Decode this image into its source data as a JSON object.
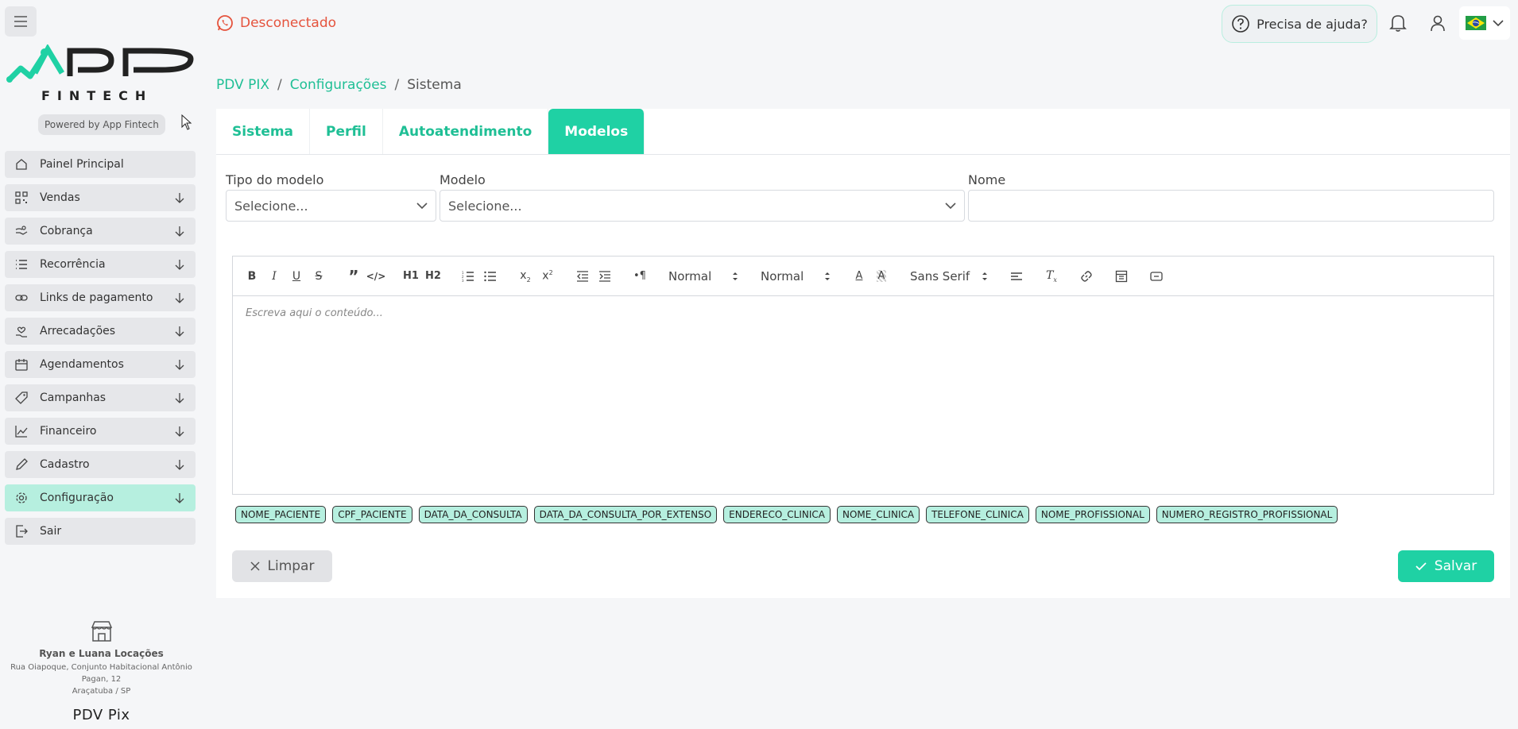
{
  "status": {
    "text": "Desconectado",
    "color": "#e5533d"
  },
  "header": {
    "help_label": "Precisa de ajuda?",
    "notification_icon": "bell-icon",
    "user_icon": "user-icon",
    "language_flag": "brazil-flag"
  },
  "brand": {
    "logo_text": "APP",
    "logo_subtext": "FINTECH",
    "powered_by": "Powered by App Fintech",
    "accent": "#1fd1a4"
  },
  "sidebar": {
    "items": [
      {
        "label": "Painel Principal",
        "icon": "home-icon",
        "has_arrow": false
      },
      {
        "label": "Vendas",
        "icon": "qr-code-icon",
        "has_arrow": true
      },
      {
        "label": "Cobrança",
        "icon": "hand-coins-icon",
        "has_arrow": true
      },
      {
        "label": "Recorrência",
        "icon": "list-icon",
        "has_arrow": true
      },
      {
        "label": "Links de pagamento",
        "icon": "link-icon",
        "has_arrow": true
      },
      {
        "label": "Arrecadações",
        "icon": "hands-heart-icon",
        "has_arrow": true
      },
      {
        "label": "Agendamentos",
        "icon": "calendar-icon",
        "has_arrow": true
      },
      {
        "label": "Campanhas",
        "icon": "tag-icon",
        "has_arrow": true
      },
      {
        "label": "Financeiro",
        "icon": "chart-line-icon",
        "has_arrow": true
      },
      {
        "label": "Cadastro",
        "icon": "pencil-icon",
        "has_arrow": true
      },
      {
        "label": "Configuração",
        "icon": "gear-icon",
        "has_arrow": true,
        "active": true
      },
      {
        "label": "Sair",
        "icon": "logout-icon",
        "has_arrow": false
      }
    ]
  },
  "store": {
    "name": "Ryan e Luana Locações",
    "address_line1": "Rua Oiapoque, Conjunto Habitacional Antônio",
    "address_line2": "Pagan, 12",
    "city": "Araçatuba / SP",
    "product": "PDV Pix"
  },
  "breadcrumb": {
    "root": "PDV PIX",
    "section": "Configurações",
    "current": "Sistema"
  },
  "tabs": [
    {
      "label": "Sistema"
    },
    {
      "label": "Perfil"
    },
    {
      "label": "Autoatendimento"
    },
    {
      "label": "Modelos",
      "active": true
    }
  ],
  "form": {
    "tipo_label": "Tipo do modelo",
    "tipo_value": "Selecione...",
    "modelo_label": "Modelo",
    "modelo_value": "Selecione...",
    "nome_label": "Nome",
    "nome_value": ""
  },
  "editor": {
    "header_select": "Normal",
    "size_select": "Normal",
    "font_select": "Sans Serif",
    "placeholder": "Escreva aqui o conteúdo...",
    "buttons": {
      "h1": "H1",
      "h2": "H2"
    }
  },
  "chips": [
    "NOME_PACIENTE",
    "CPF_PACIENTE",
    "DATA_DA_CONSULTA",
    "DATA_DA_CONSULTA_POR_EXTENSO",
    "ENDERECO_CLINICA",
    "NOME_CLINICA",
    "TELEFONE_CLINICA",
    "NOME_PROFISSIONAL",
    "NUMERO_REGISTRO_PROFISSIONAL"
  ],
  "actions": {
    "clear_label": "Limpar",
    "save_label": "Salvar"
  }
}
